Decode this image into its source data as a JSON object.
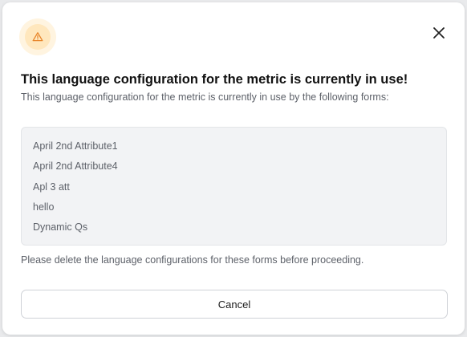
{
  "dialog": {
    "title": "This language configuration for the metric is currently in use!",
    "subtitle": "This language configuration for the metric is currently in use by the following forms:",
    "forms": [
      "April 2nd Attribute1",
      "April 2nd Attribute4",
      "Apl 3 att",
      "hello",
      "Dynamic Qs"
    ],
    "note": "Please delete the language configurations for these forms before proceeding.",
    "cancel_label": "Cancel",
    "icons": {
      "warning": "warning-icon",
      "close": "close-icon"
    },
    "colors": {
      "warning_accent": "#e8862b",
      "warning_bg": "#fff4e0"
    }
  }
}
